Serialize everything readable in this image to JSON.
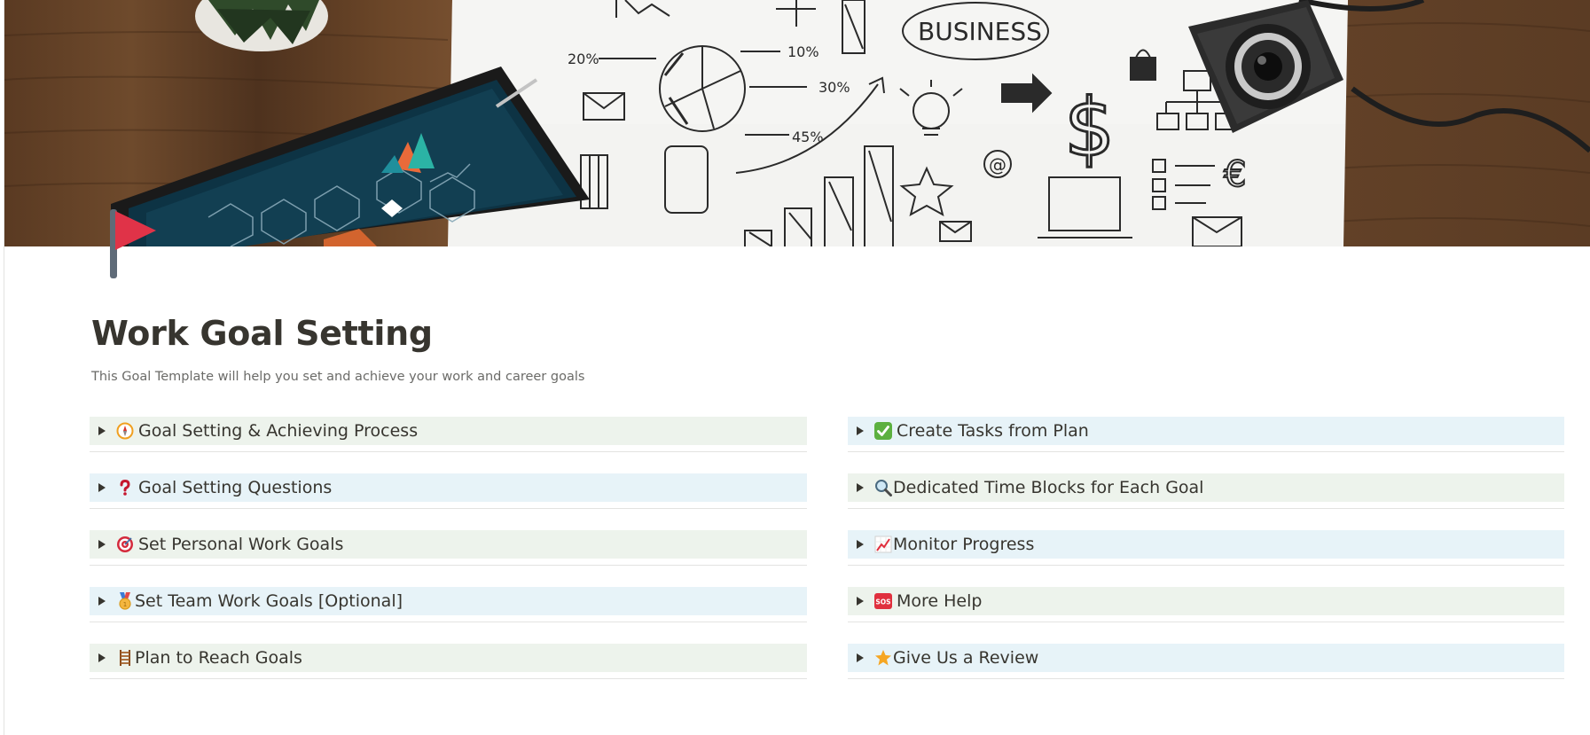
{
  "page": {
    "title": "Work Goal Setting",
    "subtitle": "This Goal Template will help you set and achieve your work and career goals",
    "cover_image": "business-doodles-desk-photo",
    "page_icon": "red-flag-icon"
  },
  "colors": {
    "green_toggle_bg": "#edf3ec",
    "blue_toggle_bg": "#e7f3f8",
    "text": "#37352f",
    "muted_text": "#6b6b68",
    "flag_red": "#e03348",
    "flag_pole": "#5f6b78"
  },
  "toggles_left": [
    {
      "label": "Goal Setting & Achieving Process",
      "icon": "compass-icon",
      "bg": "green"
    },
    {
      "label": "Goal Setting Questions",
      "icon": "question-mark-icon",
      "bg": "blue"
    },
    {
      "label": "Set Personal Work Goals",
      "icon": "target-icon",
      "bg": "green"
    },
    {
      "label": "Set Team Work Goals [Optional]",
      "icon": "medal-icon",
      "bg": "blue"
    },
    {
      "label": "Plan to Reach Goals",
      "icon": "ladder-icon",
      "bg": "green"
    }
  ],
  "toggles_right": [
    {
      "label": "Create Tasks from Plan",
      "icon": "check-mark-icon",
      "bg": "blue"
    },
    {
      "label": "Dedicated Time Blocks for Each Goal",
      "icon": "magnifier-icon",
      "bg": "green"
    },
    {
      "label": "Monitor Progress",
      "icon": "chart-up-icon",
      "bg": "blue"
    },
    {
      "label": "More Help",
      "icon": "sos-icon",
      "bg": "green"
    },
    {
      "label": "Give Us a Review",
      "icon": "star-icon",
      "bg": "blue"
    }
  ]
}
